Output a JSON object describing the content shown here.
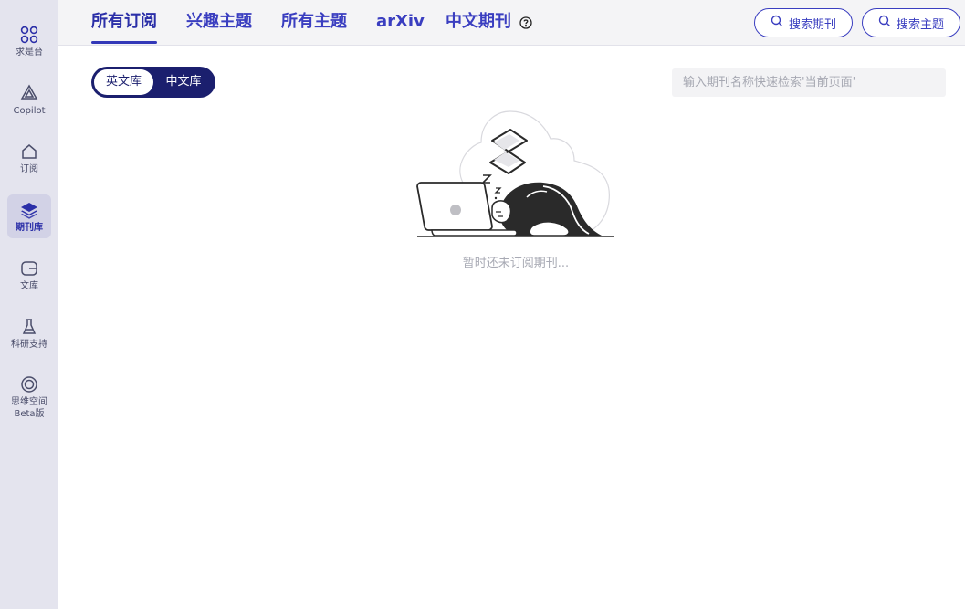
{
  "sidebar": {
    "items": [
      {
        "label": "求是台",
        "icon": "grid-icon"
      },
      {
        "label": "Copilot",
        "icon": "copilot-icon"
      },
      {
        "label": "订阅",
        "icon": "home-icon"
      },
      {
        "label": "期刊库",
        "icon": "layers-icon"
      },
      {
        "label": "文库",
        "icon": "folder-icon"
      },
      {
        "label": "科研支持",
        "icon": "flask-icon"
      },
      {
        "label": "思维空间",
        "label2": "Beta版",
        "icon": "orbit-icon"
      }
    ],
    "active_index": 3
  },
  "header": {
    "tabs": [
      {
        "label": "所有订阅"
      },
      {
        "label": "兴趣主题"
      },
      {
        "label": "所有主题"
      },
      {
        "label": "arXiv"
      },
      {
        "label": "中文期刊"
      }
    ],
    "active_tab": 0,
    "search_journal_label": "搜索期刊",
    "search_topic_label": "搜索主题"
  },
  "content": {
    "toggle": {
      "english_label": "英文库",
      "chinese_label": "中文库",
      "selected": "english"
    },
    "quick_search": {
      "placeholder": "输入期刊名称快速检索'当前页面'",
      "value": ""
    },
    "empty_message": "暂时还未订阅期刊..."
  },
  "colors": {
    "accent": "#3a3ec0",
    "accent_dark": "#1b1f6e",
    "sidebar_bg": "#e4e4ee",
    "muted_text": "#a8aab4"
  }
}
